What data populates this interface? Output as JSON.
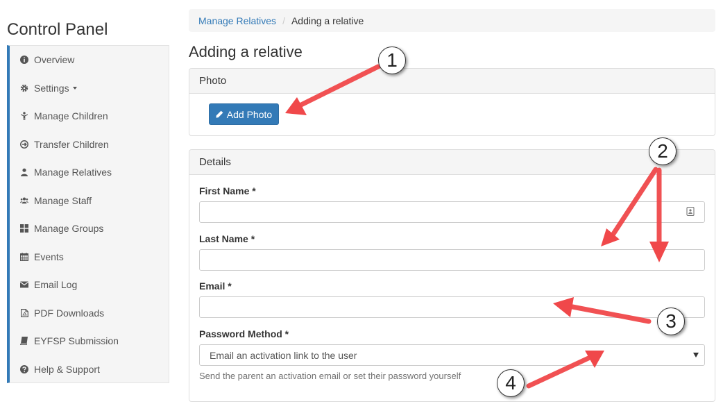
{
  "app": {
    "title": "Control Panel"
  },
  "sidebar": {
    "items": [
      {
        "label": "Overview",
        "icon": "info-icon"
      },
      {
        "label": "Settings",
        "icon": "gear-icon"
      },
      {
        "label": "Manage Children",
        "icon": "child-icon"
      },
      {
        "label": "Transfer Children",
        "icon": "transfer-icon"
      },
      {
        "label": "Manage Relatives",
        "icon": "user-icon"
      },
      {
        "label": "Manage Staff",
        "icon": "users-icon"
      },
      {
        "label": "Manage Groups",
        "icon": "grid-icon"
      },
      {
        "label": "Events",
        "icon": "calendar-icon"
      },
      {
        "label": "Email Log",
        "icon": "envelope-icon"
      },
      {
        "label": "PDF Downloads",
        "icon": "pdf-file-icon"
      },
      {
        "label": "EYFSP Submission",
        "icon": "book-icon"
      },
      {
        "label": "Help & Support",
        "icon": "help-icon"
      }
    ]
  },
  "breadcrumb": {
    "link": "Manage Relatives",
    "separator": "/",
    "current": "Adding a relative"
  },
  "page": {
    "title": "Adding a relative"
  },
  "photo_panel": {
    "heading": "Photo",
    "add_photo_label": "Add Photo"
  },
  "details_panel": {
    "heading": "Details",
    "first_name": {
      "label": "First Name *",
      "value": ""
    },
    "last_name": {
      "label": "Last Name *",
      "value": ""
    },
    "email": {
      "label": "Email *",
      "value": ""
    },
    "password_method": {
      "label": "Password Method *",
      "selected": "Email an activation link to the user",
      "help": "Send the parent an activation email or set their password yourself"
    }
  },
  "annotations": {
    "color": "#f0484a",
    "callouts": [
      "1",
      "2",
      "3",
      "4"
    ]
  },
  "colors": {
    "accent": "#337ab7",
    "panel_bg": "#f5f5f5"
  }
}
